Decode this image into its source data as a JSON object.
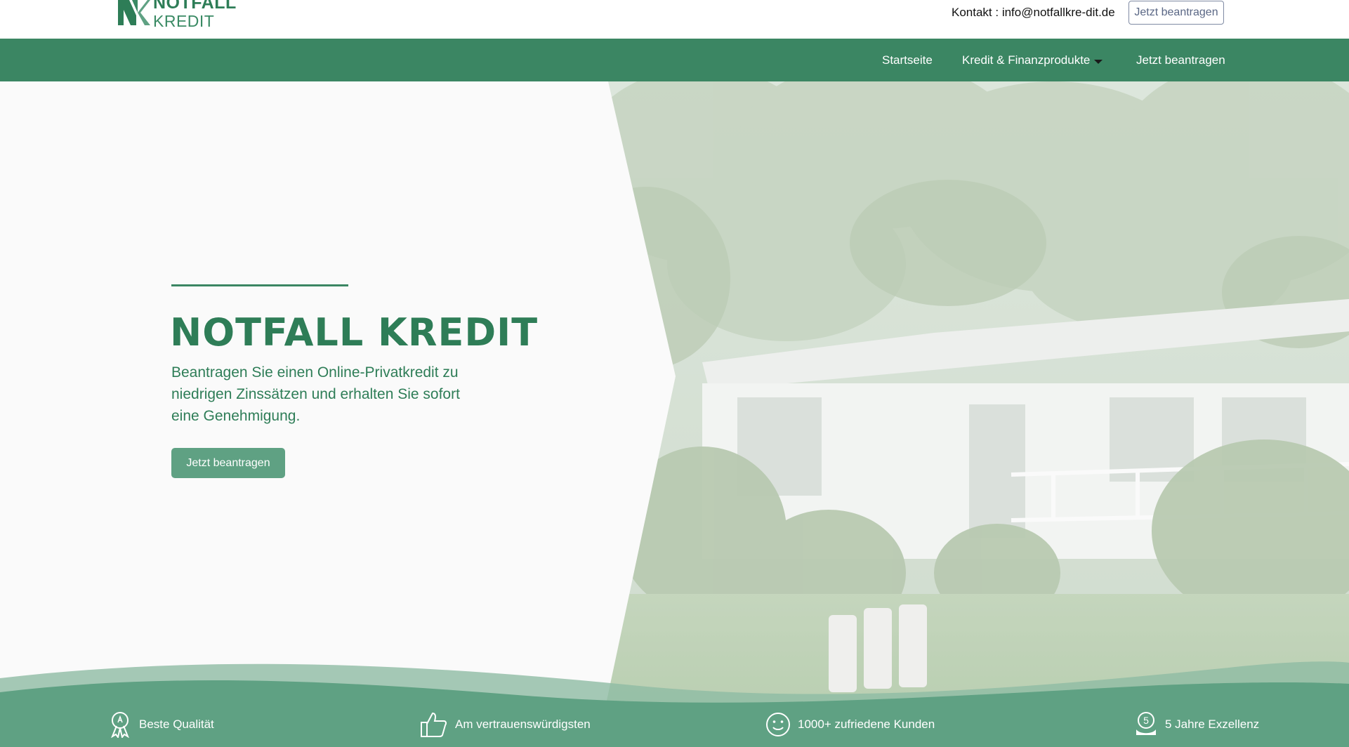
{
  "header": {
    "logo_line1": "NOTFALL",
    "logo_line2": "KREDIT",
    "contact": "Kontakt : info@notfallkre-dit.de",
    "apply_button": "Jetzt beantragen"
  },
  "nav": {
    "items": [
      {
        "label": "Startseite"
      },
      {
        "label": "Kredit & Finanzprodukte"
      },
      {
        "label": "Jetzt beantragen"
      }
    ]
  },
  "hero": {
    "title": "NOTFALL KREDIT",
    "subtitle": "Beantragen Sie einen Online-Privatkredit zu niedrigen Zinssätzen und erhalten Sie sofort eine Genehmigung.",
    "cta": "Jetzt beantragen"
  },
  "features": [
    {
      "label": "Beste Qualität",
      "icon": "award-icon"
    },
    {
      "label": "Am vertrauenswürdigsten",
      "icon": "thumbs-up-icon"
    },
    {
      "label": "1000+ zufriedene Kunden",
      "icon": "smiley-icon"
    },
    {
      "label": "5 Jahre Exzellenz",
      "icon": "five-years-icon",
      "badge": "5"
    }
  ],
  "colors": {
    "brand_green": "#3b8663",
    "dark_green": "#2e7d57",
    "button_green": "#5fa183"
  }
}
